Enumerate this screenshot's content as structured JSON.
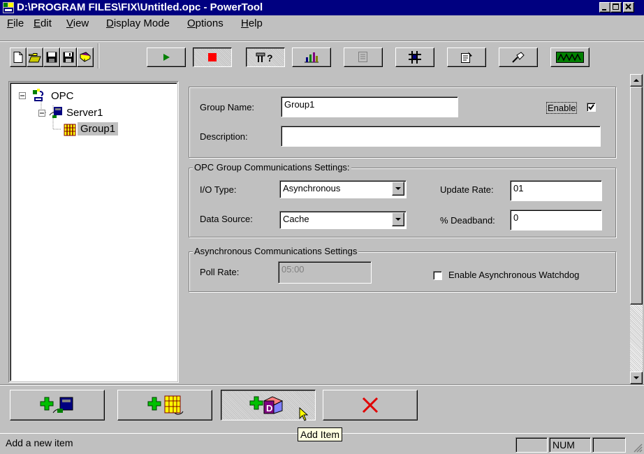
{
  "window": {
    "title": "D:\\PROGRAM FILES\\FIX\\Untitled.opc - PowerTool"
  },
  "menu": [
    {
      "mnemonic": "F",
      "rest": "ile"
    },
    {
      "mnemonic": "E",
      "rest": "dit"
    },
    {
      "mnemonic": "V",
      "rest": "iew"
    },
    {
      "mnemonic": "D",
      "rest": "isplay Mode"
    },
    {
      "mnemonic": "O",
      "rest": "ptions"
    },
    {
      "mnemonic": "H",
      "rest": "elp"
    }
  ],
  "tree": {
    "root": "OPC",
    "server": "Server1",
    "group": "Group1"
  },
  "group_form": {
    "name_label": "Group Name:",
    "name_value": "Group1",
    "enable_label": "Enable",
    "enable_checked": true,
    "description_label": "Description:",
    "description_value": ""
  },
  "opc_settings": {
    "caption": "OPC Group Communications Settings:",
    "io_type_label": "I/O Type:",
    "io_type_value": "Asynchronous",
    "data_source_label": "Data Source:",
    "data_source_value": "Cache",
    "update_rate_label": "Update Rate:",
    "update_rate_value": "01",
    "deadband_label": "% Deadband:",
    "deadband_value": "0"
  },
  "async_settings": {
    "caption": "Asynchronous Communications Settings",
    "poll_rate_label": "Poll Rate:",
    "poll_rate_value": "05:00",
    "watchdog_label": "Enable Asynchronous Watchdog",
    "watchdog_checked": false
  },
  "tooltip": "Add Item",
  "status": {
    "message": "Add a new item",
    "num": "NUM"
  },
  "colors": {
    "titlebar": "#000080",
    "face": "#c0c0c0",
    "selection": "#c0c0c0",
    "tooltip_bg": "#ffffe1"
  }
}
